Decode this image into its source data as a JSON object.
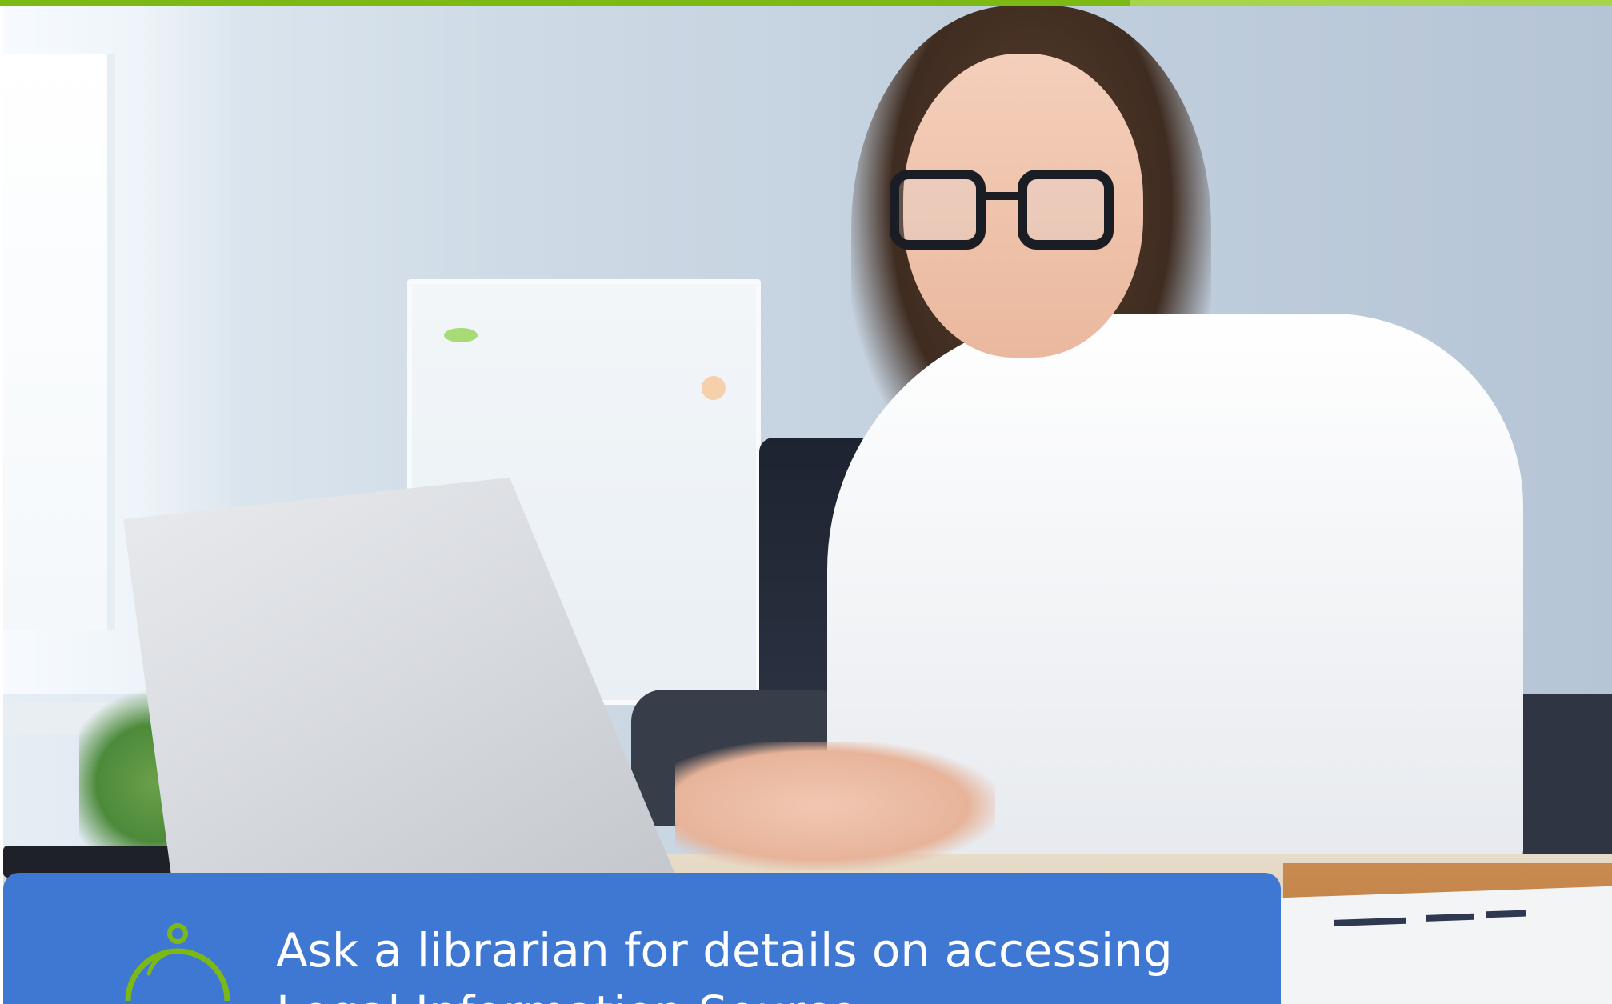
{
  "colors": {
    "accent_green_dark": "#7db914",
    "accent_green_light": "#a6d54b",
    "banner_blue": "#3f78d2",
    "icon_green": "#7db914",
    "banner_text": "#ffffff"
  },
  "hero": {
    "image_description_icon": "hero-photo"
  },
  "banner": {
    "icon": "service-bell-icon",
    "text": "Ask a librarian for details on accessing Legal Information Source"
  }
}
